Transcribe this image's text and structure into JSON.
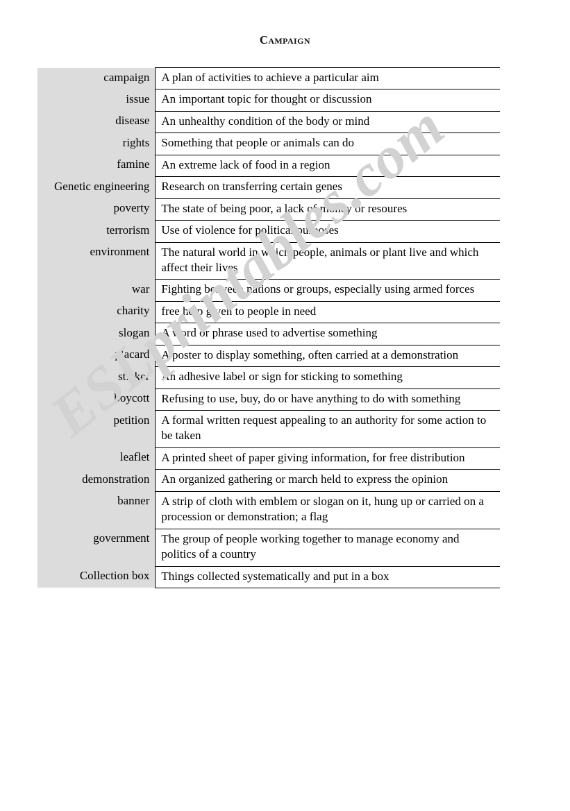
{
  "document": {
    "title": "Campaign",
    "watermark": "ESLprintables.com",
    "colors": {
      "term_column_background": "#dcdcdc",
      "rule": "#000000",
      "watermark": "#d2d2d2",
      "text": "#000000"
    }
  },
  "table": {
    "rows": [
      {
        "term": "campaign",
        "definition": "A plan of activities to achieve a particular aim"
      },
      {
        "term": "issue",
        "definition": "An important topic for thought or discussion"
      },
      {
        "term": "disease",
        "definition": "An unhealthy condition of the body or mind"
      },
      {
        "term": "rights",
        "definition": "Something that people or animals can do"
      },
      {
        "term": "famine",
        "definition": "An extreme lack of food in a region"
      },
      {
        "term": "Genetic engineering",
        "definition": "Research on transferring certain genes"
      },
      {
        "term": "poverty",
        "definition": "The state of being poor, a lack of money or resoures"
      },
      {
        "term": "terrorism",
        "definition": "Use of violence for political purposes"
      },
      {
        "term": "environment",
        "definition": "The natural world in which people, animals or plant live and which affect their lives"
      },
      {
        "term": "war",
        "definition": "Fighting between nations or groups, especially using armed forces"
      },
      {
        "term": "charity",
        "definition": "free help given to people in need"
      },
      {
        "term": "slogan",
        "definition": "A word or phrase used to advertise something"
      },
      {
        "term": "placard",
        "definition": "A poster to display something, often carried at a demonstration"
      },
      {
        "term": "sticker",
        "definition": "An adhesive label or sign for sticking to something"
      },
      {
        "term": "boycott",
        "definition": "Refusing to use, buy, do or have anything to do with something"
      },
      {
        "term": "petition",
        "definition": "A formal written request appealing to an authority for some action to be taken"
      },
      {
        "term": "leaflet",
        "definition": "A printed sheet of paper giving information, for free distribution"
      },
      {
        "term": "demonstration",
        "definition": "An organized gathering or march held to express the opinion"
      },
      {
        "term": "banner",
        "definition": "A strip of cloth with emblem or slogan on it, hung up or carried on a procession or demonstration; a flag"
      },
      {
        "term": "government",
        "definition": "The group of people working together to manage economy and politics of a country"
      },
      {
        "term": "Collection box",
        "definition": "Things collected systematically and put in a box"
      }
    ]
  }
}
